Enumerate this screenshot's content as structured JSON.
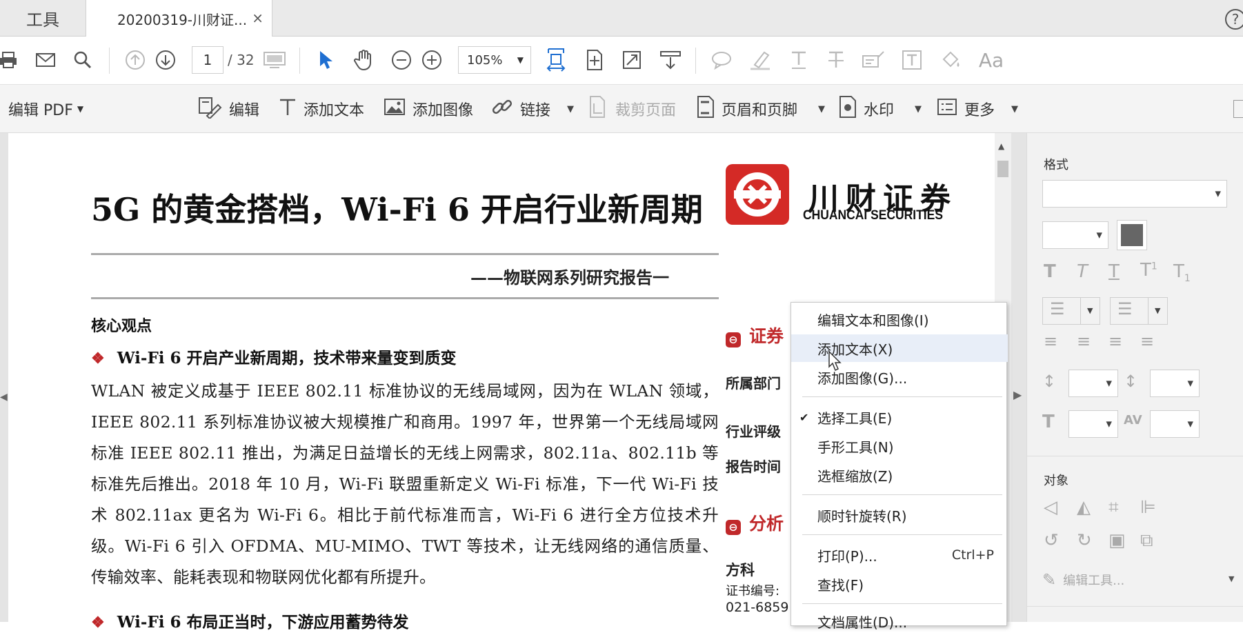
{
  "tabs": {
    "tools": "工具",
    "document": "20200319-川财证...",
    "close": "×"
  },
  "help": "?",
  "toolbar": {
    "page_current": "1",
    "page_total": "/ 32",
    "zoom": "105%"
  },
  "editbar": {
    "edit_pdf": "编辑 PDF",
    "edit": "编辑",
    "add_text": "添加文本",
    "add_image": "添加图像",
    "link": "链接",
    "crop": "裁剪页面",
    "header_footer": "页眉和页脚",
    "watermark": "水印",
    "more": "更多"
  },
  "document": {
    "title": "5G 的黄金搭档，Wi-Fi 6 开启行业新周期",
    "subtitle": "——物联网系列研究报告一",
    "heading": "核心观点",
    "bullet1": "Wi-Fi 6 开启产业新周期，技术带来量变到质变",
    "paragraph": "WLAN 被定义成基于 IEEE 802.11 标准协议的无线局域网，因为在 WLAN 领域，IEEE 802.11 系列标准协议被大规模推广和商用。1997 年，世界第一个无线局域网标准 IEEE 802.11 推出，为满足日益增长的无线上网需求，802.11a、802.11b 等标准先后推出。2018 年 10 月，Wi-Fi 联盟重新定义 Wi-Fi 标准，下一代 Wi-Fi 技术 802.11ax 更名为 Wi-Fi 6。相比于前代标准而言，Wi-Fi 6 进行全方位技术升级。Wi-Fi 6 引入 OFDMA、MU-MIMO、TWT 等技术，让无线网络的通信质量、传输效率、能耗表现和物联网优化都有所提升。",
    "bullet2": "Wi-Fi 6 布局正当时，下游应用蓄势待发",
    "logo_cn": "川财证券",
    "logo_en": "CHUANCAI SECURITIES",
    "section_red1": "证券",
    "dept_label": "所属部门",
    "rating_label": "行业评级",
    "date_label": "报告时间",
    "section_red2": "分析",
    "analyst": "方科",
    "cert": "证书编号:",
    "phone": "021-6859"
  },
  "context_menu": {
    "items": [
      {
        "label": "编辑文本和图像(I)"
      },
      {
        "label": "添加文本(X)"
      },
      {
        "label": "添加图像(G)..."
      },
      {
        "label": "选择工具(E)"
      },
      {
        "label": "手形工具(N)"
      },
      {
        "label": "选框缩放(Z)"
      },
      {
        "label": "顺时针旋转(R)"
      },
      {
        "label": "打印(P)...",
        "shortcut": "Ctrl+P"
      },
      {
        "label": "查找(F)"
      },
      {
        "label": "文档属性(D)..."
      }
    ]
  },
  "panel": {
    "format": "格式",
    "objects": "对象",
    "edit_tools": "编辑工具..."
  },
  "colors": {
    "accent_blue": "#1f6fd1",
    "brand_red": "#c0282a",
    "menu_highlight": "#e8eef8"
  }
}
